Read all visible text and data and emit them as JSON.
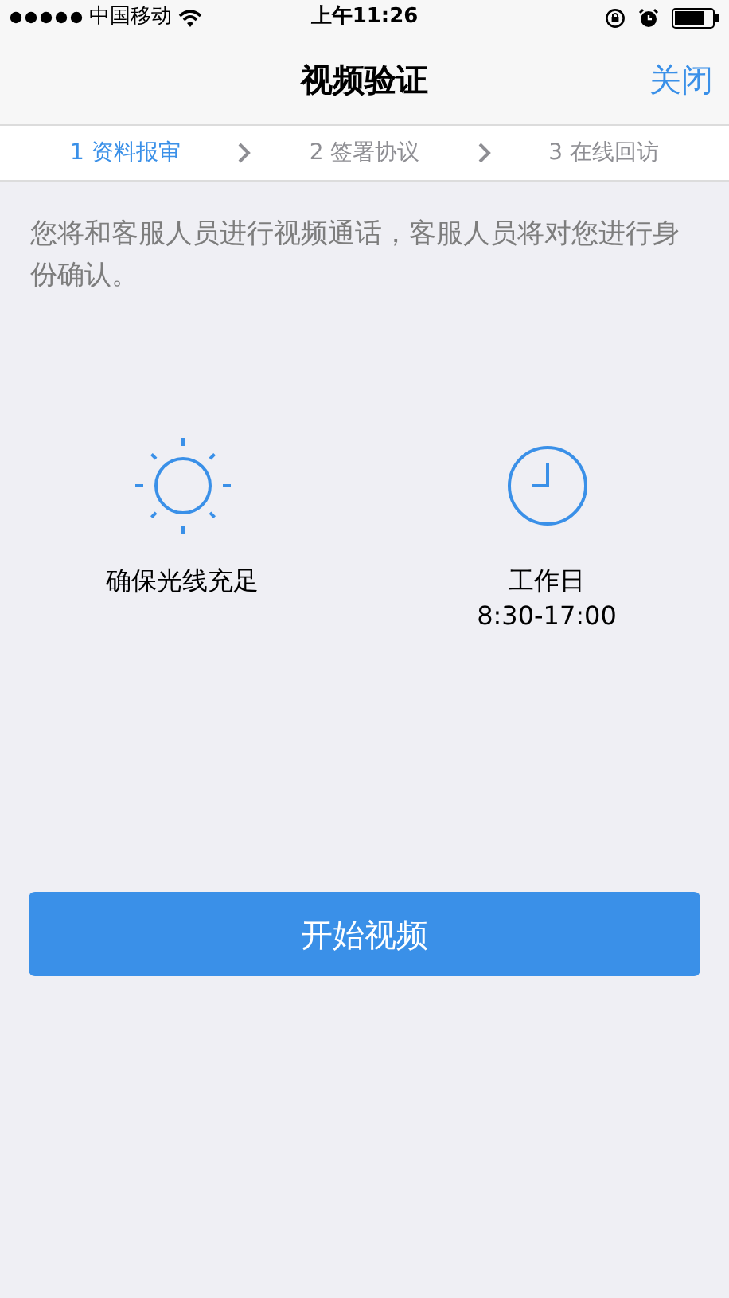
{
  "status_bar": {
    "carrier": "中国移动",
    "time": "上午11:26"
  },
  "nav": {
    "title": "视频验证",
    "close": "关闭"
  },
  "steps": [
    {
      "label": "1 资料报审",
      "selected": true
    },
    {
      "label": "2 签署协议",
      "selected": false
    },
    {
      "label": "3 在线回访",
      "selected": false
    }
  ],
  "intro": "您将和客服人员进行视频通话，客服人员将对您进行身份确认。",
  "tips": [
    {
      "kind": "sun",
      "title": "确保光线充足"
    },
    {
      "kind": "clock",
      "title": "工作日",
      "subtitle": "8:30-17:00"
    }
  ],
  "start_button": "开始视频"
}
